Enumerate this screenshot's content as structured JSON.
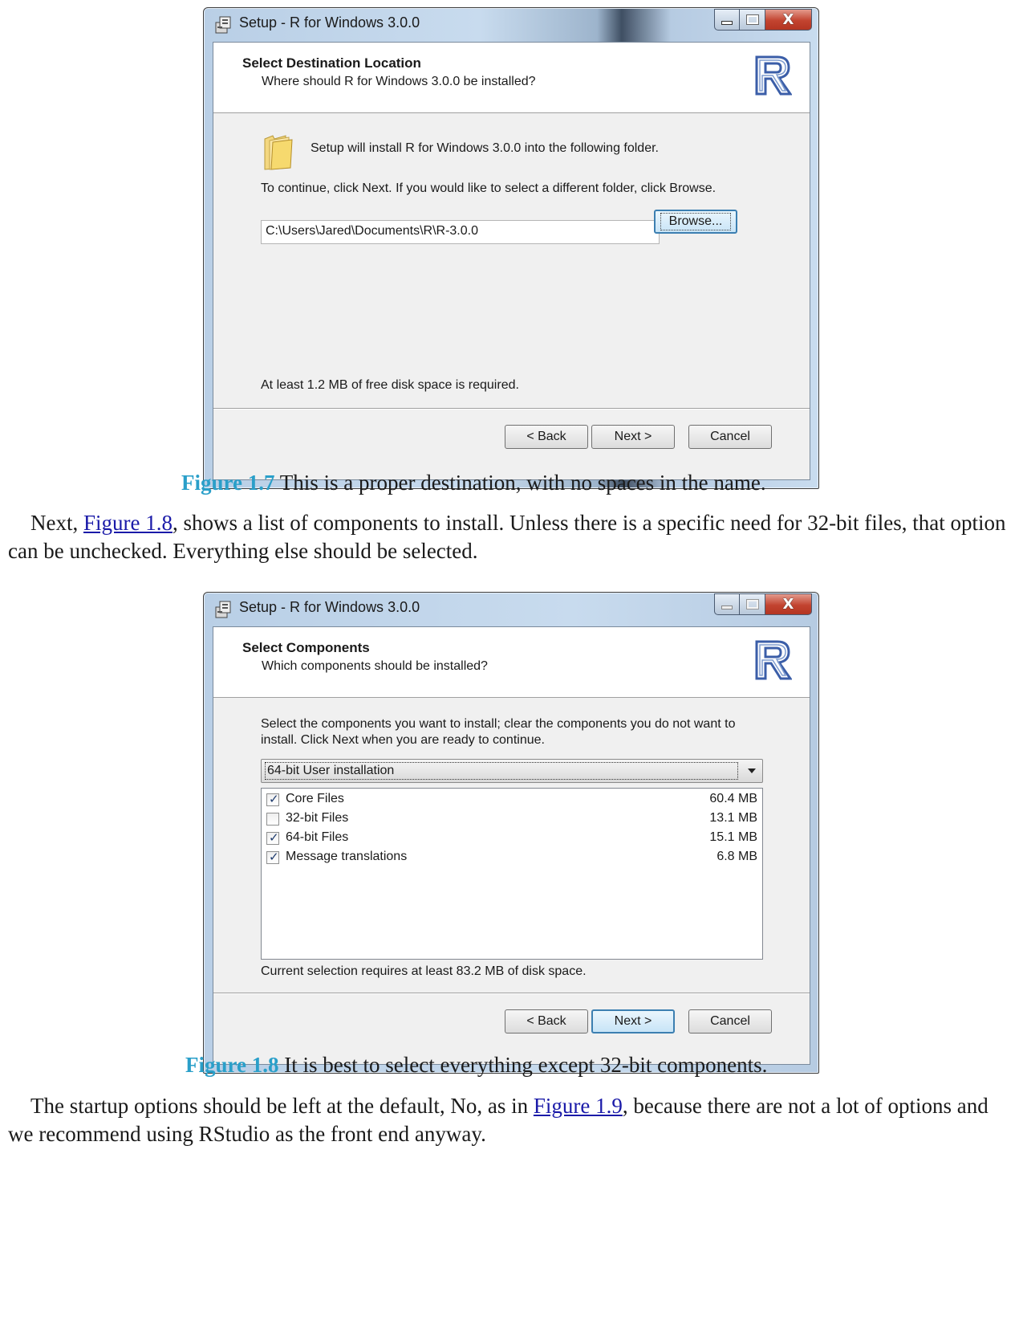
{
  "dialog1": {
    "title": "Setup - R for Windows 3.0.0",
    "close_label": "X",
    "header_title": "Select Destination Location",
    "header_subtitle": "Where should R for Windows 3.0.0 be installed?",
    "intro": "Setup will install R for Windows 3.0.0 into the following folder.",
    "instruction": "To continue, click Next. If you would like to select a different folder, click Browse.",
    "path_value": "C:\\Users\\Jared\\Documents\\R\\R-3.0.0",
    "browse_label": "Browse...",
    "disk_space": "At least 1.2 MB of free disk space is required.",
    "back_label": "< Back",
    "next_label": "Next >",
    "cancel_label": "Cancel"
  },
  "figure1": {
    "label": "Figure 1.7",
    "caption": " This is a proper destination, with no spaces in the name."
  },
  "paragraph1": {
    "before_link": "Next, ",
    "link": "Figure 1.8",
    "after_link": ", shows a list of components to install. Unless there is a specific need for 32-bit files, that option can be unchecked. Everything else should be selected."
  },
  "dialog2": {
    "title": "Setup - R for Windows 3.0.0",
    "close_label": "X",
    "header_title": "Select Components",
    "header_subtitle": "Which components should be installed?",
    "instruction_line1": "Select the components you want to install; clear the components you do not want to",
    "instruction_line2": "install. Click Next when you are ready to continue.",
    "install_type": "64-bit User installation",
    "components": [
      {
        "label": "Core Files",
        "size": "60.4 MB",
        "checked": true
      },
      {
        "label": "32-bit Files",
        "size": "13.1 MB",
        "checked": false
      },
      {
        "label": "64-bit Files",
        "size": "15.1 MB",
        "checked": true
      },
      {
        "label": "Message translations",
        "size": "6.8 MB",
        "checked": true
      }
    ],
    "selection_note": "Current selection requires at least 83.2 MB of disk space.",
    "back_label": "< Back",
    "next_label": "Next >",
    "cancel_label": "Cancel"
  },
  "figure2": {
    "label": "Figure 1.8",
    "caption": " It is best to select everything except 32-bit components."
  },
  "paragraph2": {
    "before_link": "The startup options should be left at the default, No, as in ",
    "link": "Figure 1.9",
    "after_link": ", because there are not a lot of options and we recommend using RStudio as the front end anyway."
  },
  "colors": {
    "figure_label": "#2a9fc9",
    "link": "#1a1aa8",
    "r_logo": "#3b5ea8"
  },
  "icons": [
    "setup-app-icon",
    "r-logo",
    "folder-icon",
    "checkbox-checked",
    "checkbox-unchecked",
    "dropdown-arrow-icon"
  ]
}
